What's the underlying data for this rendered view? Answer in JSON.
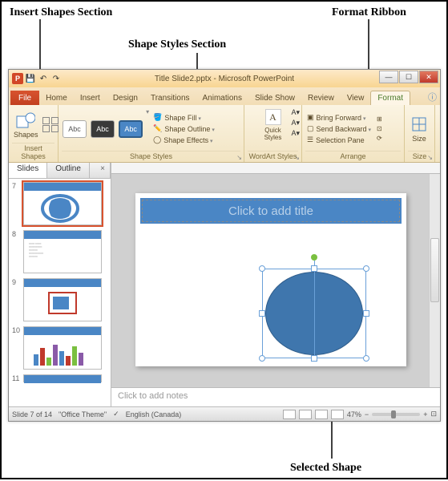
{
  "annotations": {
    "insertShapes": "Insert Shapes Section",
    "shapeStyles": "Shape Styles Section",
    "formatRibbon": "Format Ribbon",
    "selectedShape": "Selected Shape"
  },
  "window": {
    "title": "Title Slide2.pptx - Microsoft PowerPoint"
  },
  "tabs": {
    "file": "File",
    "home": "Home",
    "insert": "Insert",
    "design": "Design",
    "transitions": "Transitions",
    "animations": "Animations",
    "slideshow": "Slide Show",
    "review": "Review",
    "view": "View",
    "format": "Format"
  },
  "ribbon": {
    "insertShapes": {
      "label": "Insert Shapes",
      "shapesBtn": "Shapes"
    },
    "shapeStyles": {
      "label": "Shape Styles",
      "abc": "Abc",
      "fill": "Shape Fill",
      "outline": "Shape Outline",
      "effects": "Shape Effects"
    },
    "wordart": {
      "label": "WordArt Styles",
      "quick": "Quick\nStyles",
      "a": "A"
    },
    "arrange": {
      "label": "Arrange",
      "forward": "Bring Forward",
      "backward": "Send Backward",
      "selection": "Selection Pane"
    },
    "size": {
      "label": "Size",
      "btn": "Size"
    }
  },
  "pane": {
    "slidesTab": "Slides",
    "outlineTab": "Outline",
    "nums": [
      "7",
      "8",
      "9",
      "10",
      "11"
    ]
  },
  "slide": {
    "titlePlaceholder": "Click to add title"
  },
  "notes": {
    "placeholder": "Click to add notes"
  },
  "status": {
    "slideOf": "Slide 7 of 14",
    "theme": "\"Office Theme\"",
    "lang": "English (Canada)",
    "zoom": "47%"
  }
}
